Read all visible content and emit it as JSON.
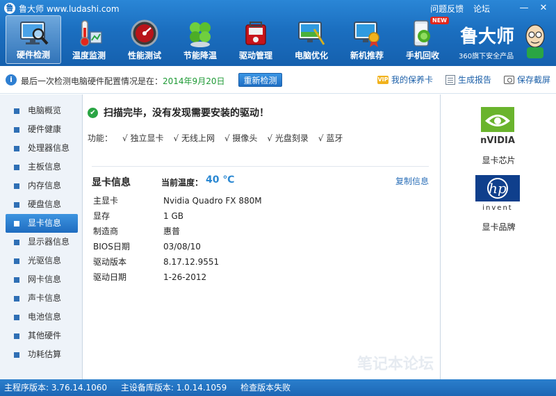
{
  "app": {
    "title": "鲁大师 www.ludashi.com",
    "logo_glyph": "鲁",
    "title_links": [
      "问题反馈",
      "论坛"
    ],
    "window_buttons": [
      "—",
      "✕"
    ]
  },
  "nav": {
    "items": [
      {
        "label": "硬件检测",
        "icon": "monitor-magnifier-icon"
      },
      {
        "label": "温度监测",
        "icon": "thermometer-icon"
      },
      {
        "label": "性能测试",
        "icon": "speedometer-icon"
      },
      {
        "label": "节能降温",
        "icon": "clover-icon"
      },
      {
        "label": "驱动管理",
        "icon": "toolbox-icon"
      },
      {
        "label": "电脑优化",
        "icon": "optimize-icon"
      },
      {
        "label": "新机推荐",
        "icon": "award-monitor-icon"
      },
      {
        "label": "手机回收",
        "icon": "phone-recycle-icon"
      }
    ],
    "new_badge": "NEW"
  },
  "brand": {
    "name": "鲁大师",
    "subtitle": "360旗下安全产品"
  },
  "infobar": {
    "text": "最后一次检测电脑硬件配置情况是在：",
    "date": "2014年9月20日",
    "recheck_label": "重新检测",
    "actions": [
      {
        "label": "我的保养卡",
        "icon": "vip-icon",
        "icon_text": "VIP"
      },
      {
        "label": "生成报告",
        "icon": "report-icon"
      },
      {
        "label": "保存截屏",
        "icon": "camera-icon"
      }
    ]
  },
  "sidebar": {
    "items": [
      "电脑概览",
      "硬件健康",
      "处理器信息",
      "主板信息",
      "内存信息",
      "硬盘信息",
      "显卡信息",
      "显示器信息",
      "光驱信息",
      "网卡信息",
      "声卡信息",
      "电池信息",
      "其他硬件",
      "功耗估算"
    ],
    "active_index": 6
  },
  "main": {
    "scan_status": "扫描完毕，没有发现需要安装的驱动！",
    "features_label": "功能：",
    "features": [
      "√ 独立显卡",
      "√ 无线上网",
      "√ 摄像头",
      "√ 光盘刻录",
      "√ 蓝牙"
    ],
    "section_title": "显卡信息",
    "temp_label": "当前温度：",
    "temp_value": "40 ℃",
    "copy_label": "复制信息",
    "rows": [
      {
        "key": "主显卡",
        "value": "Nvidia Quadro FX 880M"
      },
      {
        "key": "显存",
        "value": "1 GB"
      },
      {
        "key": "制造商",
        "value": "惠普"
      },
      {
        "key": "BIOS日期",
        "value": "03/08/10"
      },
      {
        "key": "驱动版本",
        "value": "8.17.12.9551"
      },
      {
        "key": "驱动日期",
        "value": "1-26-2012"
      }
    ],
    "watermark": "笔记本论坛"
  },
  "right": {
    "chip_vendor_text": "nVIDIA",
    "chip_label": "显卡芯片",
    "brand_vendor_text": "hp",
    "brand_vendor_sub": "invent",
    "brand_label": "显卡品牌"
  },
  "statusbar": {
    "items": [
      "主程序版本: 3.76.14.1060",
      "主设备库版本: 1.0.14.1059",
      "检查版本失败"
    ]
  },
  "colors": {
    "accent": "#1b6fc0",
    "success": "#2aa544",
    "temp": "#2b88d2",
    "date": "#1e9a35"
  }
}
